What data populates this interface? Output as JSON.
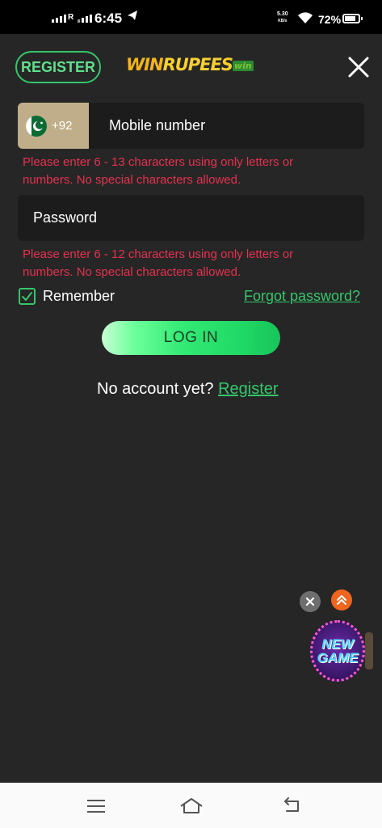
{
  "status_bar": {
    "carrier_flag": "R",
    "time": "6:45",
    "net_speed_value": "5.30",
    "net_speed_unit": "KB/s",
    "battery": "72%"
  },
  "header": {
    "register_label": "REGISTER",
    "logo_win": "WIN",
    "logo_rupees": "RUPEES",
    "logo_suffix": "win"
  },
  "form": {
    "country_code": "+92",
    "mobile_placeholder": "Mobile number",
    "mobile_error": "Please enter 6 - 13 characters using only letters or numbers. No special characters allowed.",
    "password_placeholder": "Password",
    "password_error": "Please enter 6 - 12 characters using only letters or numbers. No special characters allowed.",
    "remember_label": "Remember",
    "remember_checked": true,
    "forgot_label": "Forgot password?",
    "login_label": "LOG IN",
    "no_account_text": "No account yet?",
    "register_link": "Register"
  },
  "floating": {
    "promo_line1": "NEW",
    "promo_line2": "GAME"
  },
  "colors": {
    "background": "#262626",
    "accent_green": "#35c66a",
    "error_red": "#e5324f",
    "field_bg": "#1c1c1c"
  },
  "icons": {
    "close": "close-icon",
    "check": "check-icon",
    "flag": "pakistan-flag-icon",
    "scroll_up": "chevron-double-up-icon",
    "nav_menu": "menu-icon",
    "nav_home": "home-icon",
    "nav_back": "back-icon"
  }
}
